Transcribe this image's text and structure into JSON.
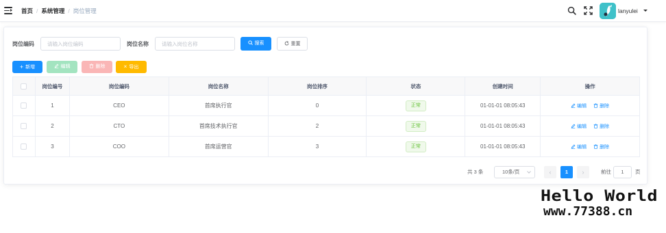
{
  "breadcrumb": {
    "items": [
      "首页",
      "系统管理"
    ],
    "separator": "/",
    "current": "岗位管理"
  },
  "user": {
    "name": "lanyulei"
  },
  "icons": {
    "menu_toggle": "hamburger-icon",
    "search": "search-icon",
    "fullscreen": "fullscreen-icon",
    "dropdown": "caret-down-icon"
  },
  "search_form": {
    "post_code_label": "岗位编码",
    "post_code_placeholder": "请输入岗位编码",
    "post_name_label": "岗位名称",
    "post_name_placeholder": "请输入岗位名称",
    "search_button": "搜索",
    "reset_button": "重置"
  },
  "toolbar": {
    "add": "新增",
    "edit": "编辑",
    "delete": "删除",
    "export": "导出"
  },
  "colors": {
    "primary": "#1890ff",
    "success_light": "#a3e4c0",
    "danger_light": "#fab6b6",
    "warning": "#ffba00",
    "status_green": "#67c23a"
  },
  "table": {
    "columns": [
      "岗位编号",
      "岗位编码",
      "岗位名称",
      "岗位排序",
      "状态",
      "创建时间",
      "操作"
    ],
    "rows": [
      {
        "id": "1",
        "code": "CEO",
        "name": "首席执行官",
        "sort": "0",
        "status": "正常",
        "created": "01-01-01 08:05:43",
        "edit": "编辑",
        "delete": "删除"
      },
      {
        "id": "2",
        "code": "CTO",
        "name": "首席技术执行官",
        "sort": "2",
        "status": "正常",
        "created": "01-01-01 08:05:43",
        "edit": "编辑",
        "delete": "删除"
      },
      {
        "id": "3",
        "code": "COO",
        "name": "首席运营官",
        "sort": "3",
        "status": "正常",
        "created": "01-01-01 08:05:43",
        "edit": "编辑",
        "delete": "删除"
      }
    ]
  },
  "pagination": {
    "total_text": "共 3 条",
    "page_size": "10条/页",
    "current_page": "1",
    "goto_label": "前往",
    "goto_value": "1",
    "page_unit": "页"
  },
  "watermark": {
    "line1": "Hello World",
    "line2": "www.77388.cn"
  }
}
